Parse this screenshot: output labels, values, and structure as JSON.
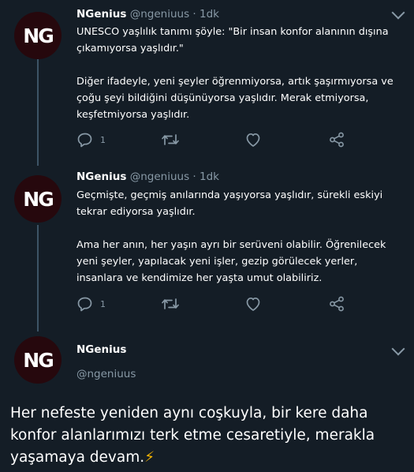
{
  "tweets": [
    {
      "avatar_text": "NG",
      "name": "NGenius",
      "handle": "@ngeniuus",
      "separator": "·",
      "time": "1dk",
      "paragraphs": [
        "UNESCO yaşlılık tanımı şöyle: \"Bir insan konfor alanının dışına çıkamıyorsa yaşlıdır.\"",
        "Diğer ifadeyle, yeni şeyler öğrenmiyorsa, artık şaşırmıyorsa ve çoğu şeyi bildiğini düşünüyorsa yaşlıdır. Merak etmiyorsa, keşfetmiyorsa yaşlıdır."
      ],
      "reply_count": "1",
      "reply_icon": "reply-bubble-icon",
      "retweet_icon": "retweet-icon",
      "like_icon": "heart-icon",
      "share_icon": "share-icon"
    },
    {
      "avatar_text": "NG",
      "name": "NGenius",
      "handle": "@ngeniuus",
      "separator": "·",
      "time": "1dk",
      "paragraphs": [
        "Geçmişte, geçmiş anılarında yaşıyorsa yaşlıdır, sürekli eskiyi tekrar ediyorsa yaşlıdır.",
        "Ama her anın, her yaşın ayrı bir serüveni olabilir. Öğrenilecek yeni şeyler, yapılacak yeni işler, gezip görülecek yerler, insanlara ve kendimize her yaşta umut olabiliriz."
      ],
      "reply_count": "1"
    },
    {
      "avatar_text": "NG",
      "name": "NGenius",
      "handle": "@ngeniuus"
    }
  ],
  "caption": {
    "text": "Her nefeste yeniden aynı coşkuyla, bir kere daha konfor alanlarımızı terk etme cesaretiyle, merakla yaşamaya devam.",
    "emoji": "⚡"
  },
  "colors": {
    "background": "#141d26",
    "muted": "#8899a6",
    "avatar": "#26080d",
    "thread_line": "#3d5466"
  }
}
